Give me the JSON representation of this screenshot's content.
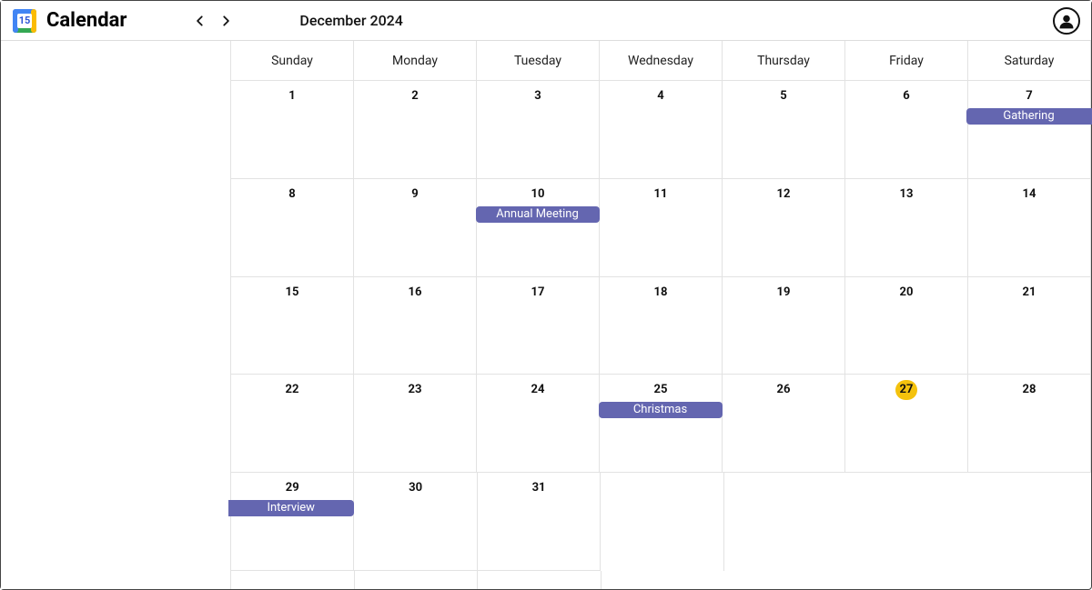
{
  "header": {
    "logo_day": "15",
    "app_title": "Calendar",
    "month_label": "December 2024"
  },
  "weekdays": [
    "Sunday",
    "Monday",
    "Tuesday",
    "Wednesday",
    "Thursday",
    "Friday",
    "Saturday"
  ],
  "today": 27,
  "days": [
    1,
    2,
    3,
    4,
    5,
    6,
    7,
    8,
    9,
    10,
    11,
    12,
    13,
    14,
    15,
    16,
    17,
    18,
    19,
    20,
    21,
    22,
    23,
    24,
    25,
    26,
    27,
    28,
    29,
    30,
    31
  ],
  "events": {
    "7": {
      "title": "Gathering",
      "edge": "right"
    },
    "10": {
      "title": "Annual Meeting",
      "edge": ""
    },
    "25": {
      "title": "Christmas",
      "edge": ""
    },
    "29": {
      "title": "Interview",
      "edge": "left"
    }
  },
  "colors": {
    "event": "#6466b0",
    "today": "#f4c20d"
  }
}
